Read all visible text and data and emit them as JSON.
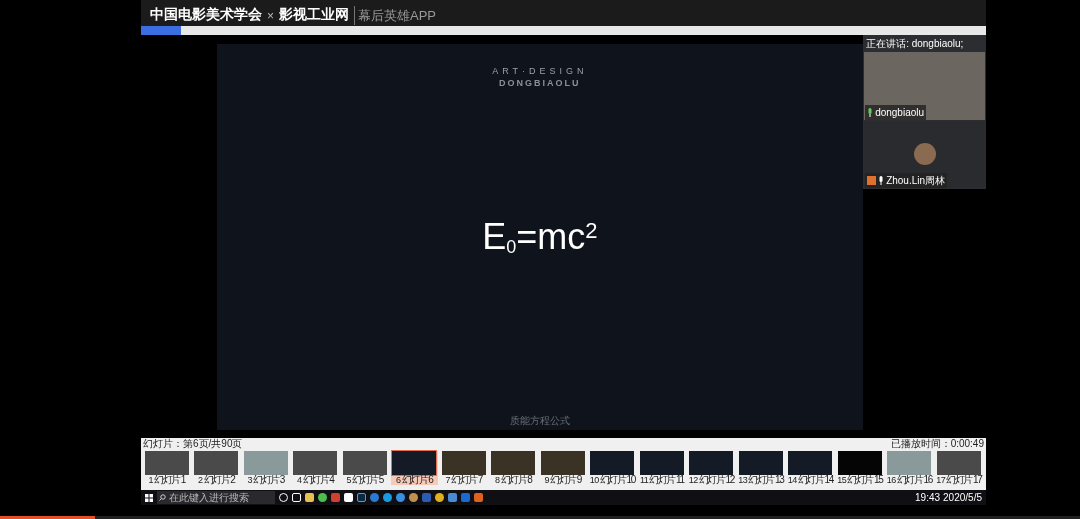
{
  "header": {
    "org": "中国电影美术学会",
    "separator": "×",
    "site": "影视工业网",
    "app": "幕后英雄APP"
  },
  "slide": {
    "brand": "ART·DESIGN",
    "subbrand": "DONGBIAOLU",
    "formula": "E$_{0}$=mc$^{2}$",
    "caption": "质能方程公式"
  },
  "video_panel": {
    "speaking": "正在讲话: dongbiaolu;",
    "participants": [
      {
        "name": "dongbiaolu",
        "kind": "camera"
      },
      {
        "name": "Zhou.Lin周林",
        "kind": "avatar"
      }
    ]
  },
  "slide_strip": {
    "position": "幻灯片：第6页/共90页",
    "elapsed": "已播放时间：0:00:49",
    "thumbnails": [
      {
        "number": "1",
        "label": "幻灯片 1",
        "kind": "photo",
        "selected": false
      },
      {
        "number": "2",
        "label": "幻灯片 2",
        "kind": "photo",
        "selected": false
      },
      {
        "number": "3",
        "label": "幻灯片 3",
        "kind": "light",
        "selected": false
      },
      {
        "number": "4",
        "label": "幻灯片 4",
        "kind": "photo",
        "selected": false
      },
      {
        "number": "5",
        "label": "幻灯片 5",
        "kind": "photo",
        "selected": false
      },
      {
        "number": "6",
        "label": "幻灯片 6",
        "kind": "dark",
        "selected": true
      },
      {
        "number": "7",
        "label": "幻灯片 7",
        "kind": "gold",
        "selected": false
      },
      {
        "number": "8",
        "label": "幻灯片 8",
        "kind": "gold",
        "selected": false
      },
      {
        "number": "9",
        "label": "幻灯片 9",
        "kind": "gold",
        "selected": false
      },
      {
        "number": "10",
        "label": "幻灯片 10",
        "kind": "dark",
        "selected": false
      },
      {
        "number": "11",
        "label": "幻灯片 11",
        "kind": "dark",
        "selected": false
      },
      {
        "number": "12",
        "label": "幻灯片 12",
        "kind": "dark",
        "selected": false
      },
      {
        "number": "13",
        "label": "幻灯片 13",
        "kind": "dark",
        "selected": false
      },
      {
        "number": "14",
        "label": "幻灯片 14",
        "kind": "dark",
        "selected": false
      },
      {
        "number": "15",
        "label": "幻灯片 15",
        "kind": "black",
        "selected": false
      },
      {
        "number": "16",
        "label": "幻灯片 16",
        "kind": "light",
        "selected": false
      },
      {
        "number": "17",
        "label": "幻灯片 17",
        "kind": "photo",
        "selected": false
      }
    ]
  },
  "taskbar": {
    "search_placeholder": "在此键入进行搜索",
    "time": "19:43",
    "date": "2020/5/5"
  },
  "playback": {
    "level": 0.088
  }
}
